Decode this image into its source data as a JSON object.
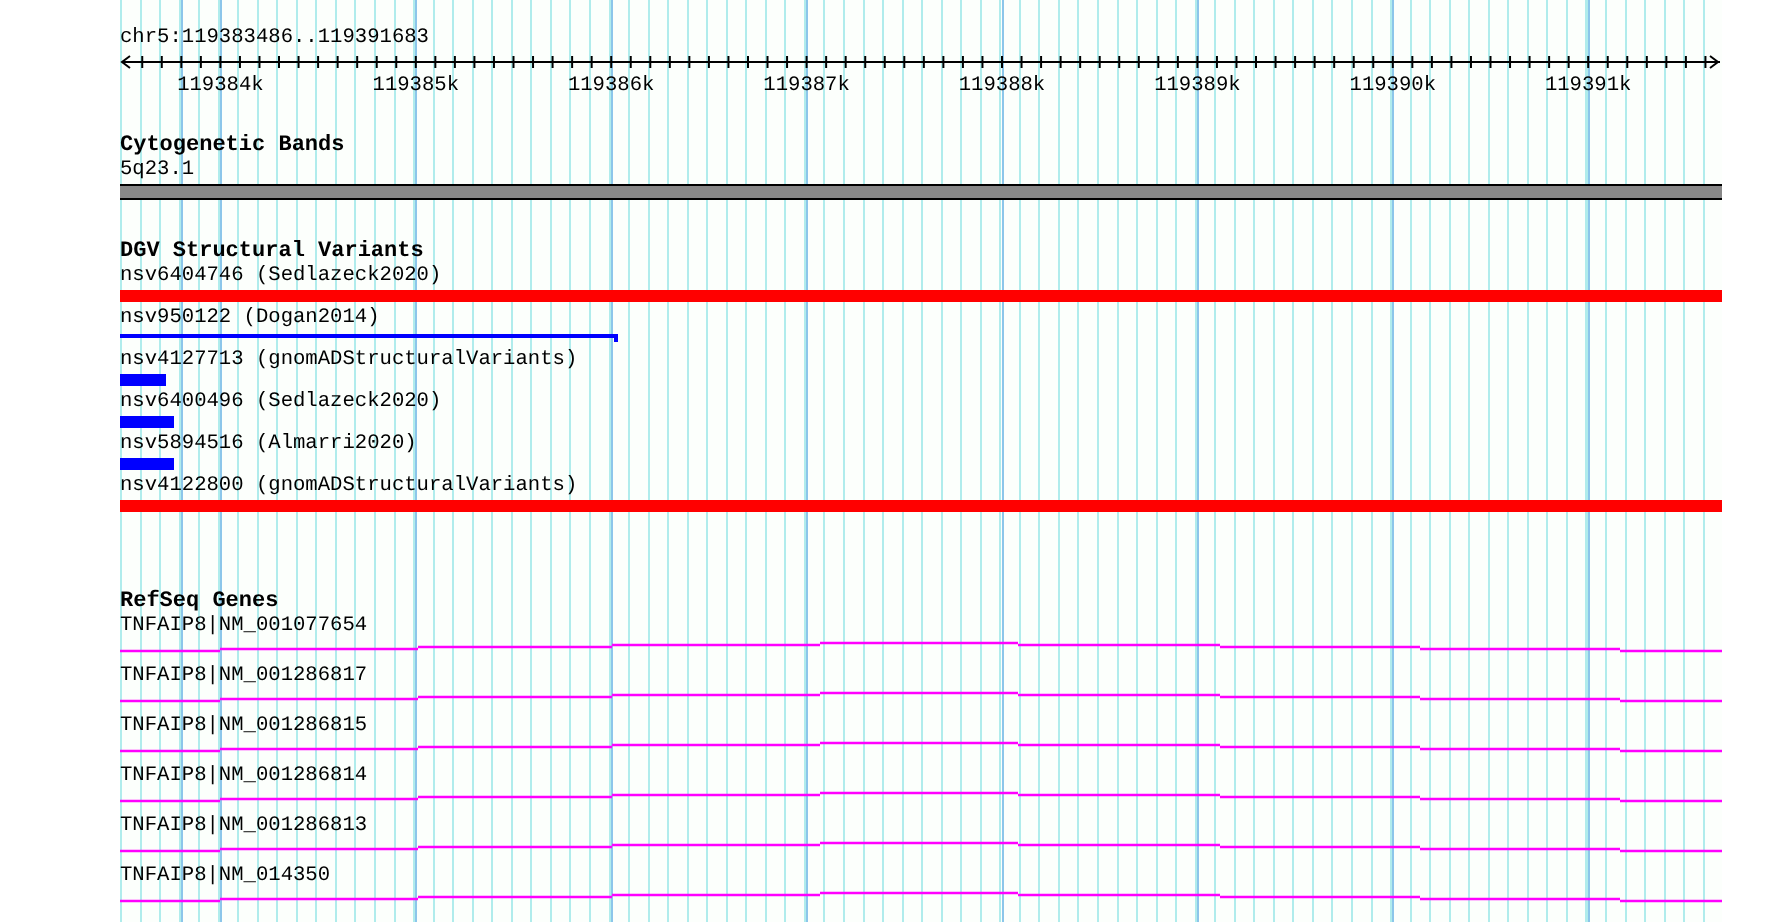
{
  "location": "chr5:119383486..119391683",
  "ruler": {
    "ticks": [
      "119384k",
      "119385k",
      "119386k",
      "119387k",
      "119388k",
      "119389k",
      "119390k",
      "119391k"
    ]
  },
  "tracks": [
    {
      "kind": "bands",
      "title": "Cytogenetic Bands",
      "label": "5q23.1"
    },
    {
      "kind": "features",
      "title": "DGV Structural Variants",
      "features": [
        {
          "label": "nsv6404746 (Sedlazeck2020)",
          "kind": "bar",
          "color": "#ff0000",
          "level": 1
        },
        {
          "label": "nsv950122 (Dogan2014)",
          "kind": "line",
          "color": "#0000ff",
          "level": 0.308
        },
        {
          "label": "nsv4127713 (gnomADStructuralVariants)",
          "kind": "bar",
          "color": "#0000ff",
          "level": 0.029
        },
        {
          "label": "nsv6400496 (Sedlazeck2020)",
          "kind": "bar",
          "color": "#0000ff",
          "level": 0.034
        },
        {
          "label": "nsv5894516 (Almarri2020)",
          "kind": "bar",
          "color": "#0000ff",
          "level": 0.034
        },
        {
          "label": "nsv4122800 (gnomADStructuralVariants)",
          "kind": "bar",
          "color": "#ff0000",
          "level": 1
        }
      ]
    },
    {
      "kind": "genes",
      "title": "RefSeq Genes",
      "genes": [
        {
          "label": "TNFAIP8|NM_001077654"
        },
        {
          "label": "TNFAIP8|NM_001286817"
        },
        {
          "label": "TNFAIP8|NM_001286815"
        },
        {
          "label": "TNFAIP8|NM_001286814"
        },
        {
          "label": "TNFAIP8|NM_001286813"
        },
        {
          "label": "TNFAIP8|NM_014350"
        }
      ]
    }
  ]
}
